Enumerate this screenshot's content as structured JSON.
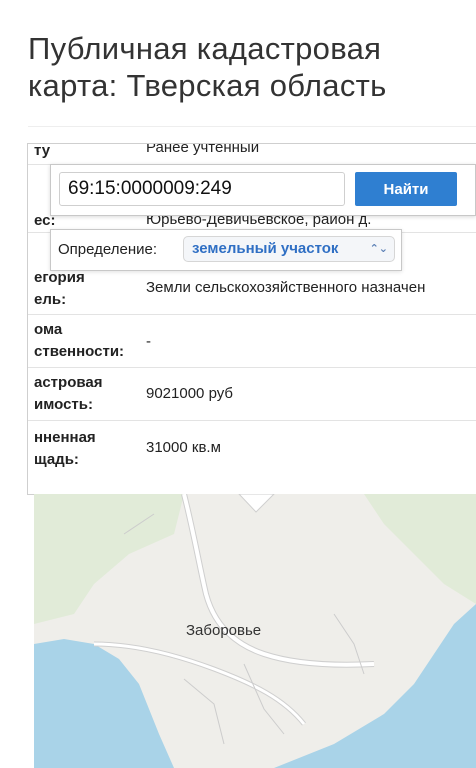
{
  "page": {
    "title_line1": "Публичная кадастровая",
    "title_line2": "карта: Тверская область"
  },
  "search": {
    "value": "69:15:0000009:249",
    "button_label": "Найти"
  },
  "definition": {
    "label": "Определение:",
    "selected": "земельный участок"
  },
  "info": [
    {
      "label": "ту",
      "value": "Ранее учтенный"
    },
    {
      "label": "ес:",
      "value": "Юрьево-Девичьевское, район д."
    },
    {
      "label": "егория\nель:",
      "value": "Земли сельскохозяйственного назначен"
    },
    {
      "label": "ома\nственности:",
      "value": "-"
    },
    {
      "label": "астровая\nимость:",
      "value": "9021000 руб"
    },
    {
      "label": "нненная\nщадь:",
      "value": "31000 кв.м"
    }
  ],
  "map": {
    "place_label": "Заборовье",
    "colors": {
      "land": "#efeeea",
      "water": "#a9d3e8",
      "forest": "#d6e9c9",
      "road": "#ffffff",
      "road_outline": "#cfcfcf"
    }
  }
}
